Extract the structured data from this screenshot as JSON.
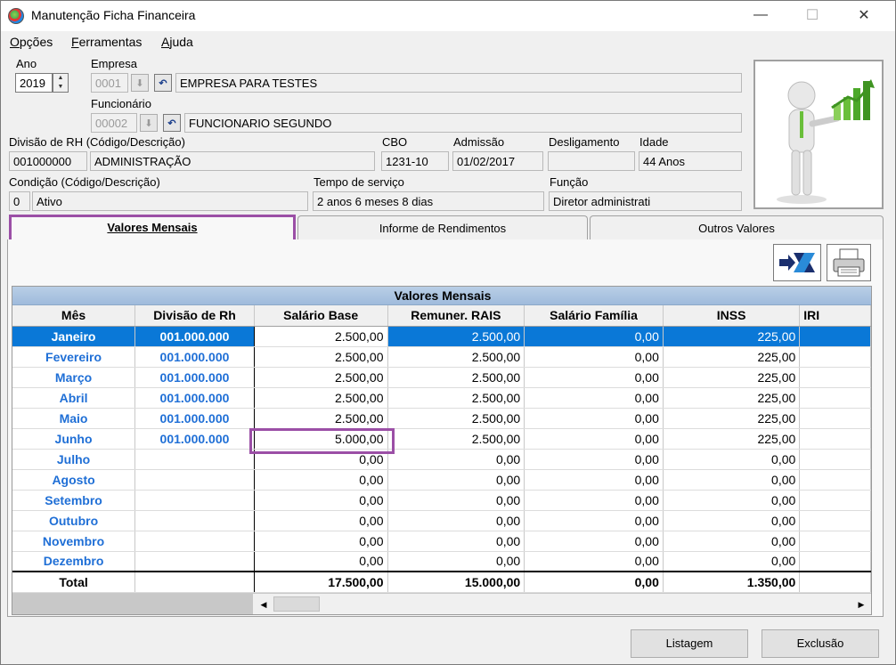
{
  "window": {
    "title": "Manutenção Ficha Financeira",
    "minimize": "—",
    "maximize": "☐",
    "close": "✕"
  },
  "menu": [
    {
      "label": "Opções",
      "accel": "O",
      "rest": "pções"
    },
    {
      "label": "Ferramentas",
      "accel": "F",
      "rest": "erramentas"
    },
    {
      "label": "Ajuda",
      "accel": "A",
      "rest": "juda"
    }
  ],
  "form": {
    "ano_label": "Ano",
    "ano_value": "2019",
    "empresa_label": "Empresa",
    "empresa_code": "0001",
    "empresa_name": "EMPRESA PARA TESTES",
    "funcionario_label": "Funcionário",
    "funcionario_code": "00002",
    "funcionario_name": "FUNCIONARIO SEGUNDO",
    "divisao_label": "Divisão de RH (Código/Descrição)",
    "divisao_code": "001000000",
    "divisao_name": "ADMINISTRAÇÃO",
    "cbo_label": "CBO",
    "cbo_value": "1231-10",
    "admissao_label": "Admissão",
    "admissao_value": "01/02/2017",
    "desligamento_label": "Desligamento",
    "desligamento_value": "",
    "idade_label": "Idade",
    "idade_value": "44 Anos",
    "condicao_label": "Condição (Código/Descrição)",
    "condicao_code": "0",
    "condicao_name": "Ativo",
    "tempo_label": "Tempo de serviço",
    "tempo_value": "2 anos 6 meses 8 dias",
    "funcao_label": "Função",
    "funcao_value": "Diretor administrati"
  },
  "tabs": [
    {
      "label": "Valores Mensais",
      "active": true
    },
    {
      "label": "Informe de Rendimentos",
      "active": false
    },
    {
      "label": "Outros Valores",
      "active": false
    }
  ],
  "grid": {
    "title": "Valores Mensais",
    "columns": [
      "Mês",
      "Divisão de Rh",
      "Salário Base",
      "Remuner. RAIS",
      "Salário Família",
      "INSS",
      "IRI"
    ],
    "rows": [
      {
        "mes": "Janeiro",
        "div": "001.000.000",
        "sal": "2.500,00",
        "rais": "2.500,00",
        "fam": "0,00",
        "inss": "225,00"
      },
      {
        "mes": "Fevereiro",
        "div": "001.000.000",
        "sal": "2.500,00",
        "rais": "2.500,00",
        "fam": "0,00",
        "inss": "225,00"
      },
      {
        "mes": "Março",
        "div": "001.000.000",
        "sal": "2.500,00",
        "rais": "2.500,00",
        "fam": "0,00",
        "inss": "225,00"
      },
      {
        "mes": "Abril",
        "div": "001.000.000",
        "sal": "2.500,00",
        "rais": "2.500,00",
        "fam": "0,00",
        "inss": "225,00"
      },
      {
        "mes": "Maio",
        "div": "001.000.000",
        "sal": "2.500,00",
        "rais": "2.500,00",
        "fam": "0,00",
        "inss": "225,00"
      },
      {
        "mes": "Junho",
        "div": "001.000.000",
        "sal": "5.000,00",
        "rais": "2.500,00",
        "fam": "0,00",
        "inss": "225,00"
      },
      {
        "mes": "Julho",
        "div": "",
        "sal": "0,00",
        "rais": "0,00",
        "fam": "0,00",
        "inss": "0,00"
      },
      {
        "mes": "Agosto",
        "div": "",
        "sal": "0,00",
        "rais": "0,00",
        "fam": "0,00",
        "inss": "0,00"
      },
      {
        "mes": "Setembro",
        "div": "",
        "sal": "0,00",
        "rais": "0,00",
        "fam": "0,00",
        "inss": "0,00"
      },
      {
        "mes": "Outubro",
        "div": "",
        "sal": "0,00",
        "rais": "0,00",
        "fam": "0,00",
        "inss": "0,00"
      },
      {
        "mes": "Novembro",
        "div": "",
        "sal": "0,00",
        "rais": "0,00",
        "fam": "0,00",
        "inss": "0,00"
      },
      {
        "mes": "Dezembro",
        "div": "",
        "sal": "0,00",
        "rais": "0,00",
        "fam": "0,00",
        "inss": "0,00"
      }
    ],
    "total": {
      "label": "Total",
      "sal": "17.500,00",
      "rais": "15.000,00",
      "fam": "0,00",
      "inss": "1.350,00"
    },
    "selected_row": 0
  },
  "buttons": {
    "listagem": "Listagem",
    "exclusao": "Exclusão"
  },
  "colors": {
    "highlight": "#9b4fa6",
    "selection": "#0a78d7",
    "month_text": "#1f6fd6"
  }
}
